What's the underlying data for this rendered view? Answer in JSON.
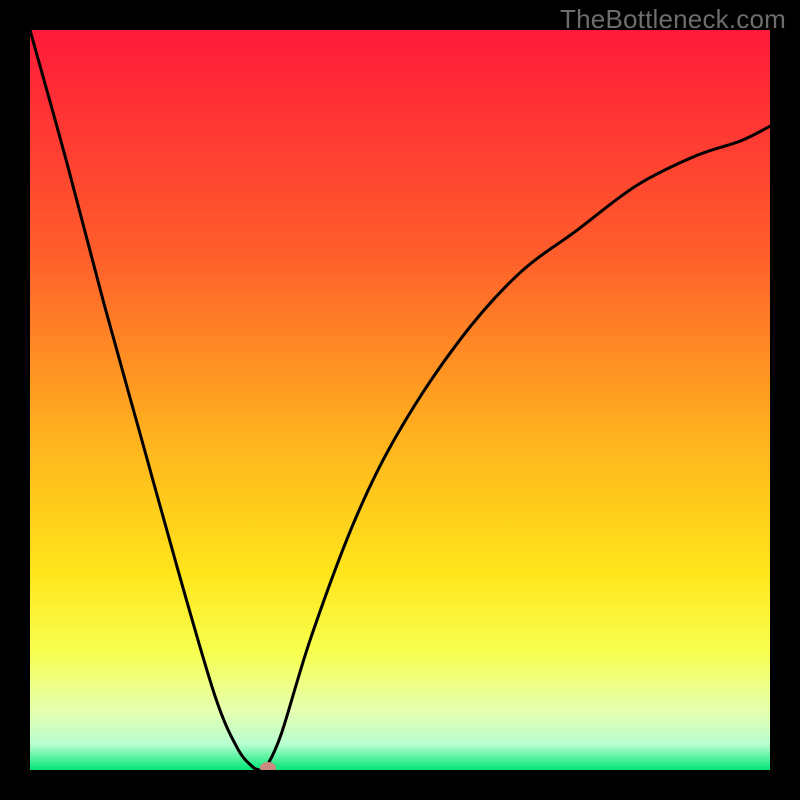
{
  "watermark": "TheBottleneck.com",
  "colors": {
    "frame": "#000000",
    "gradient_stops": [
      {
        "offset": 0.0,
        "color": "#ff1a3a"
      },
      {
        "offset": 0.3,
        "color": "#ff5d2b"
      },
      {
        "offset": 0.55,
        "color": "#ffb21e"
      },
      {
        "offset": 0.73,
        "color": "#ffe41a"
      },
      {
        "offset": 0.84,
        "color": "#f8ff4e"
      },
      {
        "offset": 0.92,
        "color": "#e5ffb0"
      },
      {
        "offset": 0.965,
        "color": "#b8ffd0"
      },
      {
        "offset": 1.0,
        "color": "#00e676"
      }
    ],
    "curve": "#000000",
    "marker": "#cb8a7d"
  },
  "chart_data": {
    "type": "line",
    "title": "",
    "xlabel": "",
    "ylabel": "",
    "x_range": [
      0,
      1
    ],
    "y_range": [
      0,
      1
    ],
    "x": [
      0.0,
      0.05,
      0.1,
      0.15,
      0.2,
      0.25,
      0.28,
      0.3,
      0.31,
      0.315,
      0.32,
      0.34,
      0.38,
      0.44,
      0.5,
      0.58,
      0.66,
      0.74,
      0.82,
      0.9,
      0.96,
      1.0
    ],
    "values": [
      1.0,
      0.82,
      0.63,
      0.45,
      0.27,
      0.1,
      0.03,
      0.005,
      0.0,
      0.0,
      0.005,
      0.05,
      0.18,
      0.34,
      0.46,
      0.58,
      0.67,
      0.73,
      0.79,
      0.83,
      0.85,
      0.87
    ],
    "minimum": {
      "x": 0.312,
      "y": 0.0
    },
    "marker": {
      "x": 0.322,
      "y": 0.003
    },
    "note": "Values are normalized to plot area (0 at bottom, 1 at top). Curve is a bottleneck-style V with an asymmetric rise."
  }
}
